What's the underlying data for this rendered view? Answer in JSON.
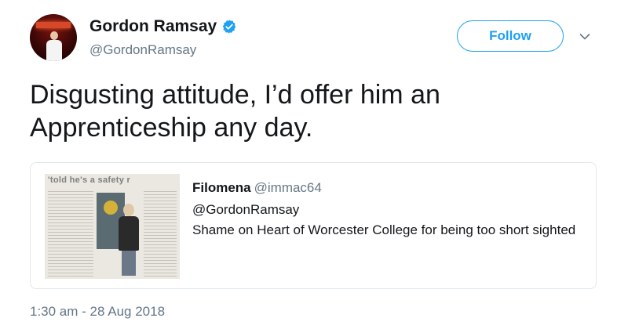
{
  "user": {
    "display_name": "Gordon Ramsay",
    "handle": "@GordonRamsay",
    "verified": true
  },
  "actions": {
    "follow_label": "Follow",
    "menu_icon": "chevron-down-icon"
  },
  "tweet": {
    "text": "Disgusting attitude, I’d offer him an Apprenticeship any day.",
    "timestamp": "1:30 am - 28 Aug 2018"
  },
  "quoted_tweet": {
    "author_name": "Filomena",
    "author_handle": "@immac64",
    "mention": "@GordonRamsay",
    "text": "Shame on Heart of Worcester College for being too short sighted",
    "thumbnail_headline": "'told he's a safety r"
  },
  "colors": {
    "accent": "#1da1f2",
    "text_primary": "#14171a",
    "text_secondary": "#657786",
    "border": "#e1e8ed"
  }
}
